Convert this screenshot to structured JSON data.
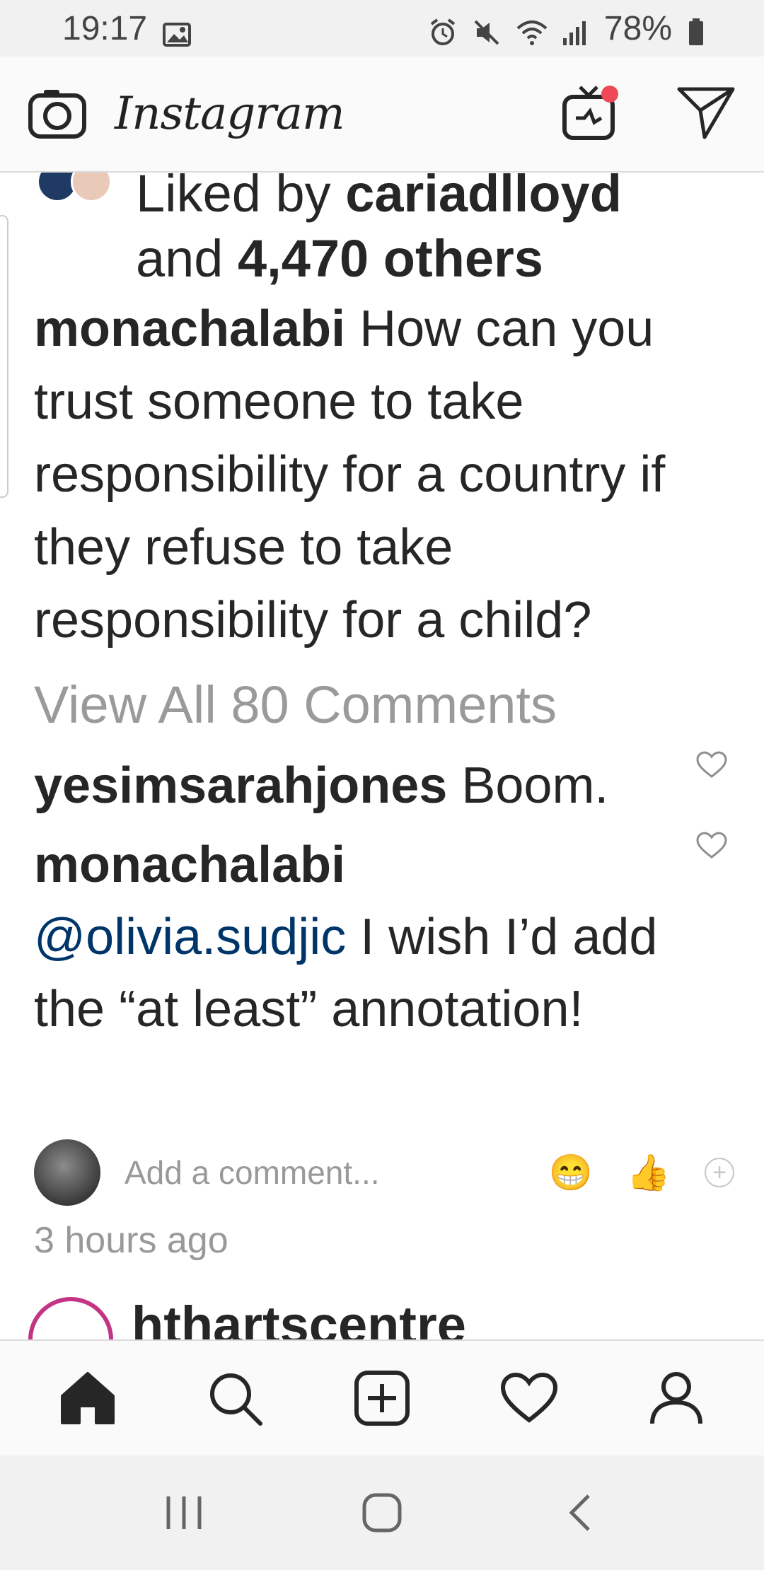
{
  "status_bar": {
    "time": "19:17",
    "battery": "78%",
    "icons": [
      "image-icon",
      "alarm-icon",
      "mute-icon",
      "wifi-icon",
      "signal-icon",
      "battery-icon"
    ]
  },
  "header": {
    "title": "Instagram",
    "icons": [
      "camera-icon",
      "igtv-icon",
      "direct-message-icon"
    ]
  },
  "post": {
    "likes": {
      "prefix": "Liked by ",
      "user": "cariadlloyd",
      "middle": " and ",
      "others": "4,470 others"
    },
    "caption": {
      "username": "monachalabi",
      "text": " How can you trust someone to take responsibility for a country if they refuse to take responsibility for a child?"
    },
    "view_all": "View All 80 Comments",
    "comments": [
      {
        "username": "yesimsarahjones",
        "text": " Boom."
      },
      {
        "username": "monachalabi",
        "mention": "@olivia.sudjic",
        "text": " I wish I’d add the “at least” annotation!"
      }
    ],
    "add_comment_placeholder": "Add a comment...",
    "quick_emojis": [
      "😁",
      "👍"
    ],
    "timestamp": "3 hours ago"
  },
  "next_post": {
    "username": "hthartscentre"
  },
  "bottom_nav": [
    "home-icon",
    "search-icon",
    "new-post-icon",
    "activity-heart-icon",
    "profile-icon"
  ],
  "system_nav": [
    "recent-apps-icon",
    "home-button-icon",
    "back-icon"
  ],
  "colors": {
    "mention": "#003569",
    "notification_dot": "#ed4956",
    "muted_text": "#999999",
    "story_ring": "#c13584"
  }
}
